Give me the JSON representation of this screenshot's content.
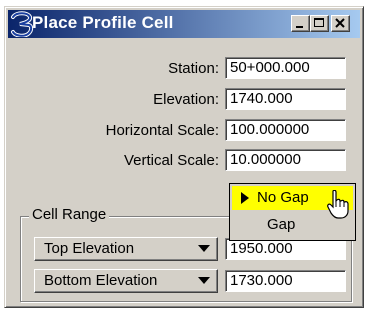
{
  "window": {
    "title": "Place Profile Cell",
    "controls": {
      "minimize": "minimize-icon",
      "maximize": "maximize-icon",
      "close": "close-icon"
    }
  },
  "fields": [
    {
      "label": "Station:",
      "value": "50+000.000"
    },
    {
      "label": "Elevation:",
      "value": "1740.000"
    },
    {
      "label": "Horizontal Scale:",
      "value": "100.000000"
    },
    {
      "label": "Vertical Scale:",
      "value": "10.000000"
    }
  ],
  "gap_menu": {
    "items": [
      {
        "label": "No Gap",
        "selected": true
      },
      {
        "label": "Gap",
        "selected": false
      }
    ],
    "highlight_color": "#ffff00"
  },
  "cell_range": {
    "title": "Cell Range",
    "rows": [
      {
        "option": "Top Elevation",
        "value": "1950.000"
      },
      {
        "option": "Bottom Elevation",
        "value": "1730.000"
      }
    ]
  },
  "colors": {
    "title_start": "#0a246a",
    "title_end": "#a6caf0",
    "face": "#d4d0c8"
  }
}
